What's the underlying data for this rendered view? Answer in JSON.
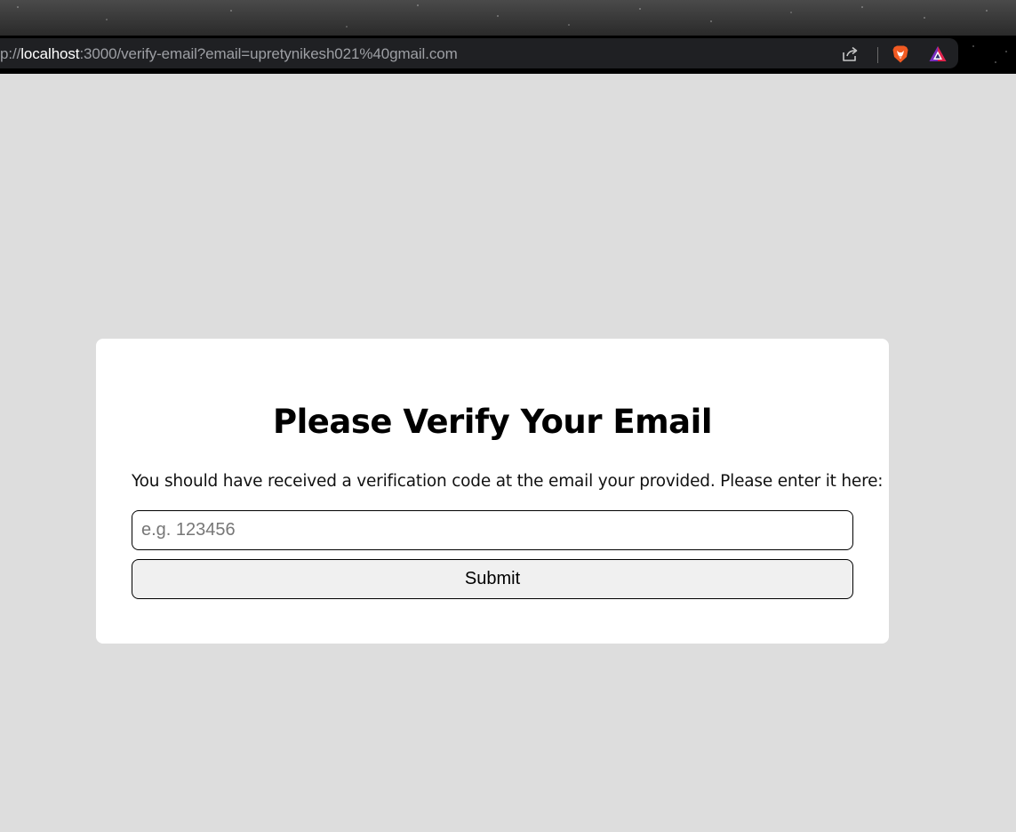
{
  "browser": {
    "url_prefix": "p://",
    "url_host": "localhost",
    "url_rest": ":3000/verify-email?email=upretynikesh021%40gmail.com",
    "icons": [
      "share-icon",
      "brave-shield-icon",
      "brave-rewards-icon"
    ]
  },
  "card": {
    "title": "Please Verify Your Email",
    "instructions": "You should have received a verification code at the email your provided. Please enter it here:",
    "code_placeholder": "e.g. 123456",
    "submit_label": "Submit"
  },
  "colors": {
    "page_background": "#dddddd",
    "card_background": "#ffffff",
    "button_background": "#f0f0f0",
    "toolbar_background": "#000000",
    "address_bar_background": "#1f2023"
  }
}
